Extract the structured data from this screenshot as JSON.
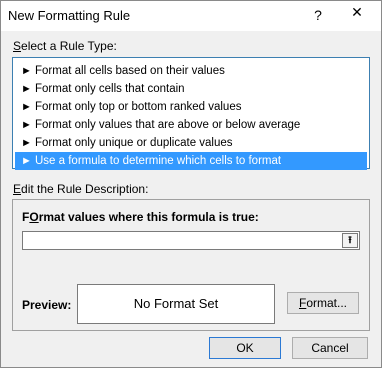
{
  "window": {
    "title": "New Formatting Rule",
    "help_glyph": "?",
    "close_glyph": "✕"
  },
  "rule_type": {
    "label_prefix": "",
    "label_accel": "S",
    "label_rest": "elect a Rule Type:",
    "arrow": "►",
    "items": [
      {
        "label": "Format all cells based on their values",
        "selected": false
      },
      {
        "label": "Format only cells that contain",
        "selected": false
      },
      {
        "label": "Format only top or bottom ranked values",
        "selected": false
      },
      {
        "label": "Format only values that are above or below average",
        "selected": false
      },
      {
        "label": "Format only unique or duplicate values",
        "selected": false
      },
      {
        "label": "Use a formula to determine which cells to format",
        "selected": true
      }
    ]
  },
  "description": {
    "label_accel": "E",
    "label_rest": "dit the Rule Description:",
    "formula_label_accel": "O",
    "formula_label_pre": "F",
    "formula_label_rest": "rmat values where this formula is true:",
    "formula_value": "",
    "collapse_glyph": "⭱",
    "preview_label": "Preview:",
    "preview_text": "No Format Set",
    "format_button_accel": "F",
    "format_button_rest": "ormat..."
  },
  "buttons": {
    "ok": "OK",
    "cancel": "Cancel"
  },
  "colors": {
    "selection": "#3399ff",
    "list_border": "#3c7fb1",
    "ok_border": "#2b79d4"
  }
}
